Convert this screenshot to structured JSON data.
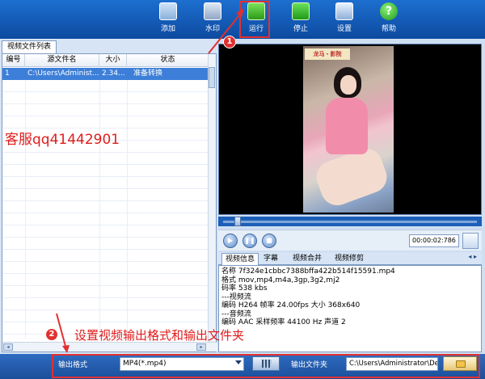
{
  "toolbar": {
    "buttons": [
      {
        "label": "添加",
        "icon": "add-icon"
      },
      {
        "label": "水印",
        "icon": "watermark-icon"
      },
      {
        "label": "运行",
        "icon": "run-icon"
      },
      {
        "label": "停止",
        "icon": "stop-icon"
      },
      {
        "label": "设置",
        "icon": "settings-icon"
      },
      {
        "label": "帮助",
        "icon": "help-icon"
      }
    ],
    "help_glyph": "?"
  },
  "file_list": {
    "tab_label": "视频文件列表",
    "columns": [
      "编号",
      "源文件名",
      "大小",
      "状态"
    ],
    "rows": [
      {
        "index": "1",
        "source": "C:\\Users\\Administ...",
        "size": "2.34...",
        "status": "准备转换"
      }
    ]
  },
  "overlay_watermark": "客服qq41442901",
  "preview": {
    "logo_text": "龙马・影院",
    "time": "00:00:02:786"
  },
  "info_tabs": {
    "tabs": [
      "视频信息",
      "字幕",
      "视频合并",
      "视频修剪"
    ],
    "arrows": "◂ ▸"
  },
  "video_info": {
    "lines": [
      "名称  7f324e1cbbc7388bffa422b514f15591.mp4",
      "格式  mov,mp4,m4a,3gp,3g2,mj2",
      "码率  538 kbs",
      "---视频流",
      "编码  H264  帧率  24.00fps  大小  368x640",
      "---音频流",
      "编码  AAC  采样频率  44100 Hz  声道  2"
    ]
  },
  "bottom": {
    "format_label": "输出格式",
    "format_value": "MP4(*.mp4)",
    "folder_label": "输出文件夹",
    "folder_value": "C:\\Users\\Administrator\\Des"
  },
  "annotations": {
    "badge1": "1",
    "badge2": "2",
    "text2": "设置视频输出格式和输出文件夹"
  },
  "colors": {
    "toolbar": "#0d4aa0",
    "selection": "#3d7fd8",
    "annotation_red": "#e23030"
  }
}
